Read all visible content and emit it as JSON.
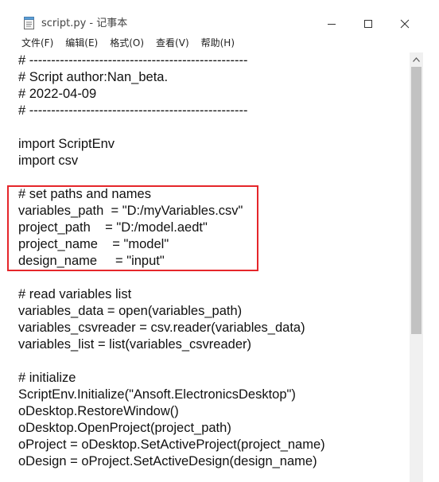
{
  "window": {
    "title": "script.py - 记事本",
    "minimize_icon": "minimize-icon",
    "maximize_icon": "maximize-icon",
    "close_icon": "close-icon"
  },
  "menu": {
    "items": [
      {
        "label": "文件(F)"
      },
      {
        "label": "编辑(E)"
      },
      {
        "label": "格式(O)"
      },
      {
        "label": "查看(V)"
      },
      {
        "label": "帮助(H)"
      }
    ]
  },
  "editor": {
    "lines": [
      "# --------------------------------------------------",
      "# Script author:Nan_beta.",
      "# 2022-04-09",
      "# --------------------------------------------------",
      "",
      "import ScriptEnv",
      "import csv",
      "",
      "# set paths and names",
      "variables_path  = \"D:/myVariables.csv\"",
      "project_path    = \"D:/model.aedt\"",
      "project_name    = \"model\"",
      "design_name     = \"input\"",
      "",
      "# read variables list",
      "variables_data = open(variables_path)",
      "variables_csvreader = csv.reader(variables_data)",
      "variables_list = list(variables_csvreader)",
      "",
      "# initialize",
      "ScriptEnv.Initialize(\"Ansoft.ElectronicsDesktop\")",
      "oDesktop.RestoreWindow()",
      "oDesktop.OpenProject(project_path)",
      "oProject = oDesktop.SetActiveProject(project_name)",
      "oDesign = oProject.SetActiveDesign(design_name)"
    ]
  },
  "annotation": {
    "highlight_color": "#e5262a"
  }
}
